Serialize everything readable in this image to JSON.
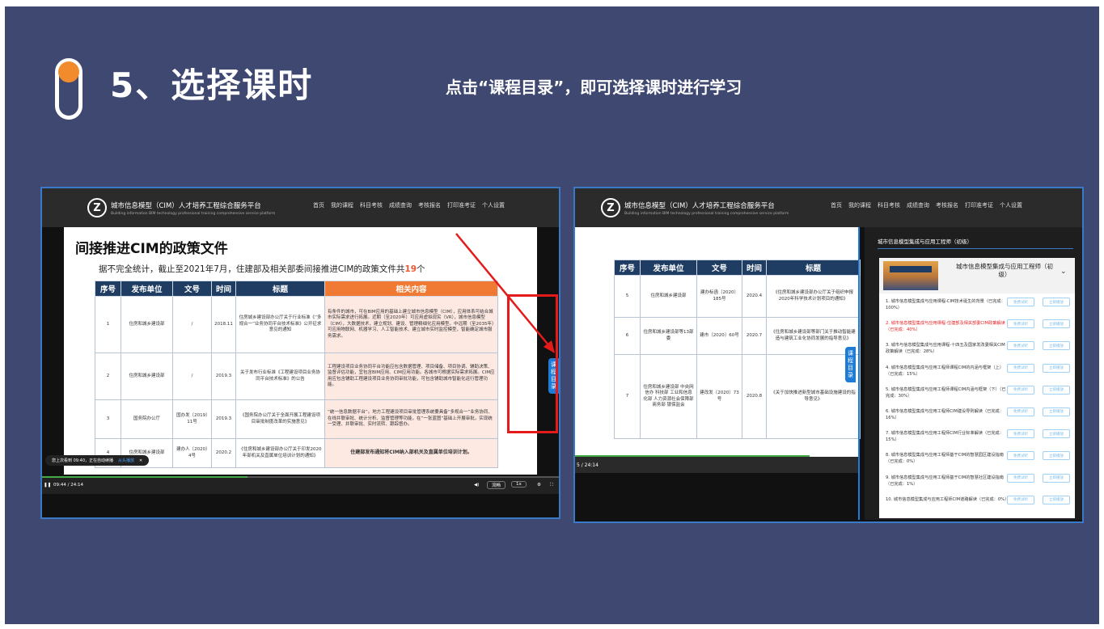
{
  "slide": {
    "title": "5、选择课时",
    "subtitle": "点击“课程目录”，即可选择课时进行学习"
  },
  "site": {
    "logo_letter": "Z",
    "title": "城市信息模型（CIM）人才培养工程综合服务平台",
    "title_en": "Building information BIM technology professional training comprehensive service platform",
    "nav": [
      "首页",
      "我的课程",
      "科目考核",
      "成绩查询",
      "考核报名",
      "打印准考证",
      "个人设置"
    ]
  },
  "left_player": {
    "heading": "间接推进CIM的政策文件",
    "summary_prefix": "据不完全统计，截止至2021年7月，住建部及相关部委间接推进CIM的政策文件共",
    "summary_count": "19",
    "summary_suffix": "个",
    "table": {
      "headers": [
        "序号",
        "发布单位",
        "文号",
        "时间",
        "标题",
        "相关内容"
      ],
      "rows": [
        [
          "1",
          "住房和城乡建设部",
          "/",
          "2018.11",
          "住房城乡建设部办公厅关于行业标准《“多规合一”业务协同平台技术标准》公开征求意见的通知",
          "有条件的城市，可在BIM应用的基础上建立城市信息模型（CIM），应用体系可结合城市实际需求进行拓展。近期（至2020年）可应用虚拟现实（VR），城市信息模型（CIM），大数据技术，建立规划、建设、管理精细化应用模型。中远期（至2035年）可应用物联网、机器学习、人工智能技术、建立城市实时监控模型，智能确定城市服务需求。"
        ],
        [
          "2",
          "住房和城乡建设部",
          "/",
          "2019.3",
          "关于发布行业标准《工程建设项目业务协同平台技术标准》的公告",
          "工程建设项目业务协同平台功能应包含数据管理、项目储备、项目协调、辅助决策、监督评估功能，宜包含BIM应用、CIM应用功能。各城市可根据实际需求拓展。CIM应用应包含辅助工程建设项目业务协同审批功能，可包含辅助城市智能化运行管理功能。"
        ],
        [
          "3",
          "国务院办公厅",
          "国办发〔2019〕11号",
          "2019.3",
          "《国务院办公厅关于全面开展工程建设项目审批制度改革的实施意见》",
          "“统一信息数据平台”。地方工程建设项目审批管理系统要具备“多规合一”业务协同、在线并联审批、统计分析、监督管理等功能，在“一张蓝图”基础上开展审批，实现统一受理、并联审批、实时流转、跟踪督办。"
        ],
        [
          "4",
          "住房和城乡建设部",
          "建办人〔2020〕4号",
          "2020.2",
          "《住房和城乡建设部办公厅关于印发2020年部机关及直属单位培训计划的通知》",
          "住建部发布通知将CIM纳入部机关及直属单位培训计划。"
        ]
      ]
    },
    "resume_tip": "您上次看到 09:40，正在自动续播",
    "resume_link": "从头播放",
    "time": "09:44 / 24:14",
    "speed_label": "流畅",
    "rate_label": "1x",
    "toc_tab": "课程目录"
  },
  "right_player": {
    "table": {
      "headers": [
        "序号",
        "发布单位",
        "文号",
        "时间",
        "标题"
      ],
      "rows": [
        [
          "5",
          "住房和城乡建设部",
          "建办标函〔2020〕185号",
          "2020.4",
          "《住房和城乡建设部办公厅关于组织申报2020年科学技术计划项目的通知》"
        ],
        [
          "6",
          "住房和城乡建设部等13部委",
          "建市〔2020〕60号",
          "2020.7",
          "《住房和城乡建设部等部门关于推动智能建造与建筑工业化协同发展的指导意见》"
        ],
        [
          "7",
          "住房和城乡建设部 中央网信办 科技部 工业和信息化部 人力资源社会保障部 商务部 银保监会",
          "建改发〔2020〕73号",
          "2020.8",
          "《关于加快推进新型城市基础设施建设的指导意见》"
        ]
      ]
    },
    "time": "5 / 24:14",
    "toc_tab": "课程目录",
    "panel_title": "城市信息模型集成与应用工程师（初级）",
    "course_name": "城市信息模型集成与应用工程师（初级）",
    "lessons": [
      {
        "title": "1. 城市信息模型集成与应用课程-CIM技术诞生的背景（已完成：100%）",
        "active": false
      },
      {
        "title": "2. 城市信息模型集成与应用课程-住建部及相关部委CIM政策解读（已完成：40%）",
        "active": true
      },
      {
        "title": "3. 城市与信息模型集成与应用课程-十四五及国家发改委相关CIM政策解读（已完成：28%）",
        "active": false
      },
      {
        "title": "4. 城市信息模型集成与应用工程师课程CIM的内涵与框架（上）（已完成：15%）",
        "active": false
      },
      {
        "title": "5. 城市信息模型集成与应用工程师课程CIM内涵与框架（下）（已完成：30%）",
        "active": false
      },
      {
        "title": "6. 城市信息模型集成与应用工程师CIM建设导则解读（已完成：16%）",
        "active": false
      },
      {
        "title": "7. 城市信息模型集成与应用工程师CIM行业标准解读（已完成：15%）",
        "active": false
      },
      {
        "title": "8. 城市信息模型集成与应用工程师基于CIM的智慧园区建设指南（已完成：0%）",
        "active": false
      },
      {
        "title": "9. 城市信息模型集成与应用工程师基于CIM的智慧社区建设指南（已完成：1%）",
        "active": false
      },
      {
        "title": "10. 城市信息模型集成与应用工程师CIM道路解读（已完成：0%）",
        "active": false
      }
    ],
    "btn_free": "免费试听",
    "btn_play": "立即播放"
  }
}
